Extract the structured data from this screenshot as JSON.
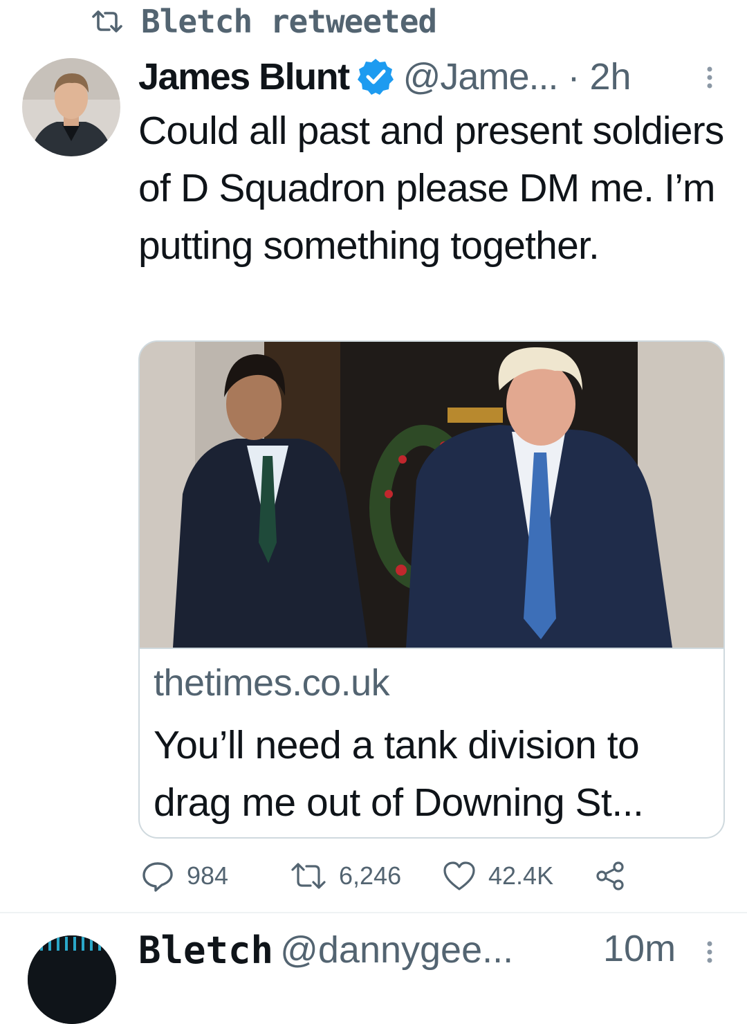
{
  "retweet_banner": {
    "icon": "retweet-icon",
    "text": "Bletch retweeted"
  },
  "tweet": {
    "author_name": "James Blunt",
    "verified": true,
    "handle": "@Jame...",
    "separator": "·",
    "time": "2h",
    "text": "Could all past and present soldiers of D Squadron please DM me. I’m putting something together.",
    "card": {
      "domain": "thetimes.co.uk",
      "title": "You’ll need a tank division to drag me out of Downing St..."
    },
    "actions": {
      "replies": "984",
      "retweets": "6,246",
      "likes": "42.4K"
    }
  },
  "next_tweet": {
    "author_name": "Bletch",
    "handle": "@dannygee...",
    "time": "10m"
  },
  "colors": {
    "text_primary": "#0f1419",
    "text_secondary": "#536471",
    "verified_blue": "#1d9bf0",
    "border": "#cfd9de"
  }
}
